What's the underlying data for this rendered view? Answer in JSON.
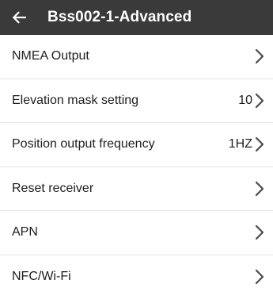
{
  "header": {
    "title": "Bss002-1-Advanced",
    "back_icon": "arrow-left-icon",
    "background_color": "#3a3a3a",
    "text_color": "#ffffff"
  },
  "settings": {
    "items": [
      {
        "label": "NMEA Output",
        "value": ""
      },
      {
        "label": "Elevation mask setting",
        "value": "10"
      },
      {
        "label": "Position output frequency",
        "value": "1HZ"
      },
      {
        "label": "Reset receiver",
        "value": ""
      },
      {
        "label": "APN",
        "value": ""
      },
      {
        "label": "NFC/Wi-Fi",
        "value": ""
      }
    ],
    "chevron_icon": "chevron-right-icon"
  }
}
